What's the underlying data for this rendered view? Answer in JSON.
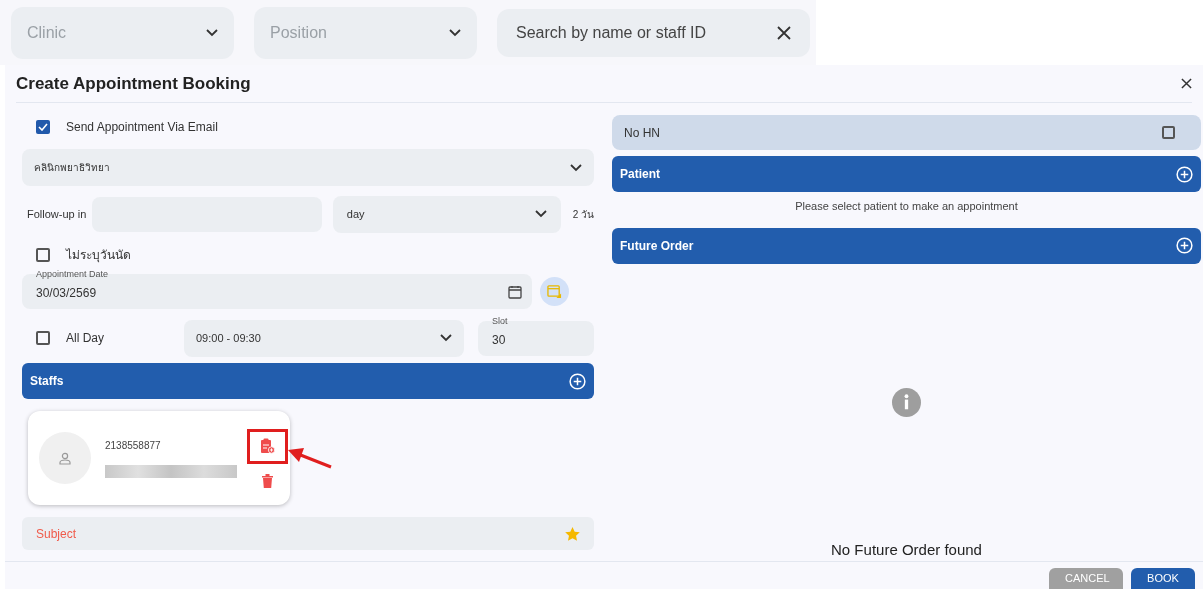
{
  "filters": [
    {
      "kind": "select",
      "placeholder": "Clinic"
    },
    {
      "kind": "select",
      "placeholder": "Position"
    },
    {
      "kind": "search",
      "placeholder": "Search by name or staff ID"
    }
  ],
  "dialog": {
    "title": "Create Appointment Booking",
    "send_email": {
      "label": "Send Appointment Via Email",
      "checked": true
    },
    "clinic_select": {
      "value": "คลินิกพยาธิวิทยา"
    },
    "follow_up": {
      "label": "Follow-up in",
      "unit": "day",
      "note": "2 วัน"
    },
    "no_date": {
      "label": "ไม่ระบุวันนัด",
      "checked": false
    },
    "appointment_date": {
      "label": "Appointment Date",
      "value": "30/03/2569"
    },
    "all_day": {
      "label": "All Day",
      "checked": false
    },
    "time_select": {
      "value": "09:00 - 09:30"
    },
    "slot": {
      "label": "Slot",
      "value": "30"
    },
    "staffs": {
      "title": "Staffs",
      "members": [
        {
          "staff_id": "2138558877"
        }
      ]
    },
    "subject": {
      "placeholder": "Subject"
    },
    "no_hn": {
      "label": "No HN",
      "checked": false
    },
    "patient": {
      "title": "Patient",
      "message": "Please select patient to make an appointment"
    },
    "future_order": {
      "title": "Future Order",
      "empty_message": "No Future Order found"
    },
    "buttons": [
      {
        "label": "CANCEL",
        "kind": "secondary"
      },
      {
        "label": "BOOK",
        "kind": "primary"
      }
    ]
  }
}
